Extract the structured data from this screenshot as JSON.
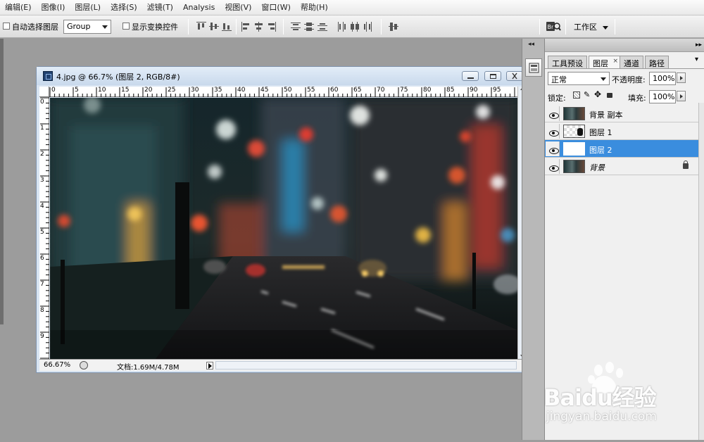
{
  "menubar": {
    "items": [
      "编辑(E)",
      "图像(I)",
      "图层(L)",
      "选择(S)",
      "滤镜(T)",
      "Analysis",
      "视图(V)",
      "窗口(W)",
      "帮助(H)"
    ]
  },
  "options": {
    "auto_select_label": "自动选择图层",
    "group_value": "Group",
    "show_transform_label": "显示变换控件",
    "workspace_label": "工作区"
  },
  "document": {
    "title": "4.jpg @ 66.7% (图层 2, RGB/8#)",
    "ruler_top": [
      "0",
      "5",
      "10",
      "15",
      "20",
      "25",
      "30",
      "35",
      "40",
      "45",
      "50",
      "55",
      "60",
      "65",
      "70",
      "75",
      "80",
      "85",
      "90",
      "95"
    ],
    "ruler_left": [
      "0",
      "1",
      "2",
      "3",
      "4",
      "5",
      "6",
      "7",
      "8",
      "9"
    ],
    "zoom": "66.67%",
    "doc_size": "文档:1.69M/4.78M"
  },
  "layers_panel": {
    "tabs": [
      "工具预设",
      "图层",
      "通道",
      "路径"
    ],
    "blend_mode": "正常",
    "opacity_label": "不透明度:",
    "opacity_value": "100%",
    "lock_label": "锁定:",
    "fill_label": "填充:",
    "fill_value": "100%",
    "layers": [
      {
        "name": "背景 副本",
        "thumb": "photo"
      },
      {
        "name": "图层 1",
        "thumb": "transparent"
      },
      {
        "name": "图层 2",
        "thumb": "white",
        "selected": true
      },
      {
        "name": "背景",
        "thumb": "photo",
        "locked": true
      }
    ]
  },
  "watermark": {
    "brand": "Baidu经验",
    "url": "jingyan.baidu.com"
  },
  "colors": {
    "selected_layer": "#3a8dde",
    "workspace_bg": "#9c9c9c"
  }
}
